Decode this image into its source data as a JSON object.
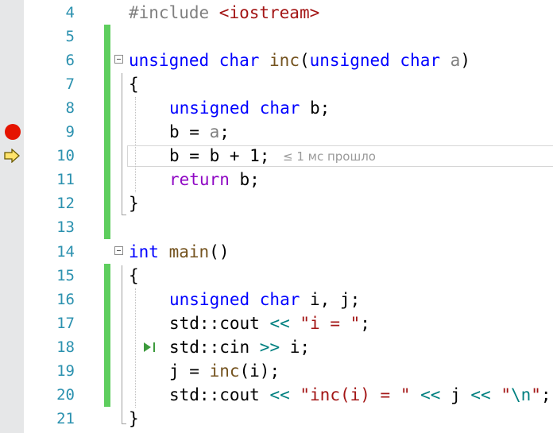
{
  "editor": {
    "lines": [
      {
        "num": "4"
      },
      {
        "num": "5"
      },
      {
        "num": "6"
      },
      {
        "num": "7"
      },
      {
        "num": "8"
      },
      {
        "num": "9"
      },
      {
        "num": "10"
      },
      {
        "num": "11"
      },
      {
        "num": "12"
      },
      {
        "num": "13"
      },
      {
        "num": "14"
      },
      {
        "num": "15"
      },
      {
        "num": "16"
      },
      {
        "num": "17"
      },
      {
        "num": "18"
      },
      {
        "num": "19"
      },
      {
        "num": "20"
      },
      {
        "num": "21"
      }
    ],
    "code": {
      "l4_pp": "#include ",
      "l4_inc": "<iostream>",
      "l6_kw1": "unsigned char",
      "l6_fn": "inc",
      "l6_p1": "(",
      "l6_kw2": "unsigned char",
      "l6_param": "a",
      "l6_p2": ")",
      "l7": "{",
      "l8_kw": "unsigned char",
      "l8_rest": " b;",
      "l9": "b = ",
      "l9_param": "a",
      "l9_end": ";",
      "l10": "b = b + 1;",
      "l11_kw": "return",
      "l11_rest": " b;",
      "l12": "}",
      "l14_kw": "int",
      "l14_fn": "main",
      "l14_rest": "()",
      "l15": "{",
      "l16_kw": "unsigned char",
      "l16_rest": " i, j;",
      "l17_a": "std::cout ",
      "l17_op": "<<",
      "l17_str": "\"i = \"",
      "l17_end": ";",
      "l18_a": "std::cin ",
      "l18_op": ">>",
      "l18_end": " i;",
      "l19_a": "j = ",
      "l19_fn": "inc",
      "l19_end": "(i);",
      "l20_a": "std::cout ",
      "l20_op1": "<<",
      "l20_str1": "\"inc(i) = \"",
      "l20_op2": "<<",
      "l20_j": " j ",
      "l20_op3": "<<",
      "l20_str2a": "\"",
      "l20_esc": "\\n",
      "l20_str2b": "\"",
      "l20_end": ";",
      "l21": "}"
    },
    "perf_tip": "≤ 1 мс прошло",
    "colors": {
      "breakpoint": "#e51400",
      "change_bar": "#5ece5e",
      "line_number": "#2b91af",
      "keyword": "#0000ff"
    },
    "icons": {
      "breakpoint": "breakpoint-icon",
      "next_statement": "next-statement-arrow-icon",
      "run_to_click": "run-to-click-icon"
    }
  }
}
